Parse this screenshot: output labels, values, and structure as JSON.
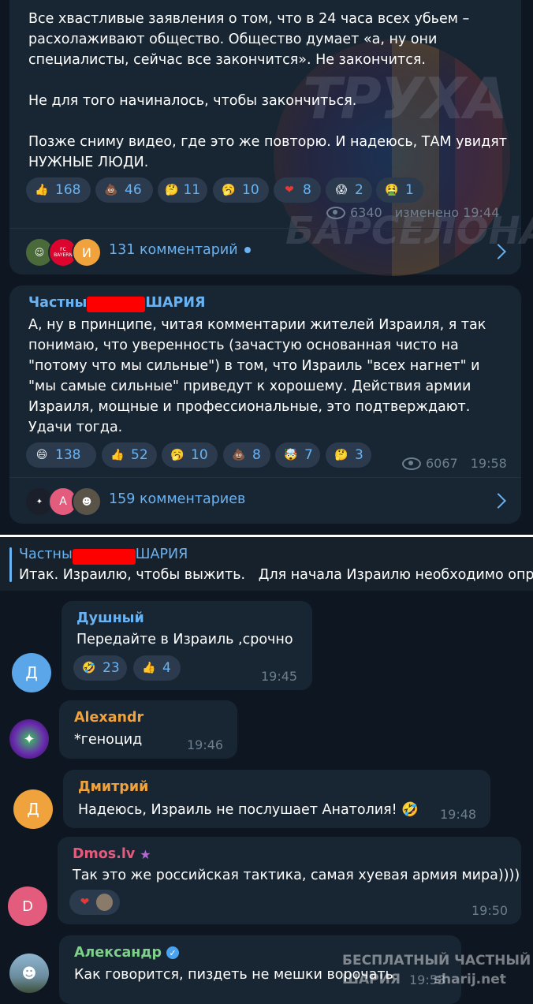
{
  "post1": {
    "text": "Все хвастливые заявления о том, что в 24 часа всех убьем –\nрасхолаживают общество. Общество думает «а, ну они\nспециалисты, сейчас все закончится». Не закончится.\n\nНе для того начиналось, чтобы закончиться.\n\nПозже сниму видео, где это же повторю. И надеюсь, ТАМ увидят\nНУЖНЫЕ ЛЮДИ.",
    "reactions": [
      {
        "emoji": "👍",
        "count": "168"
      },
      {
        "emoji": "💩",
        "count": "46"
      },
      {
        "emoji": "🤔",
        "count": "11"
      },
      {
        "emoji": "🥱",
        "count": "10"
      },
      {
        "emoji": "❤",
        "count": "8"
      },
      {
        "emoji": "😱",
        "count": "2"
      },
      {
        "emoji": "🤮",
        "count": "1"
      }
    ],
    "views": "6340",
    "edited": "изменено 19:44",
    "comments_label": "131 комментарий",
    "watermark_top": "ТРУХА",
    "watermark_bottom": "БАРСЕЛОНА",
    "avatar_badge": "FC BAYERN",
    "avatar_letter": "И"
  },
  "post2": {
    "author_start": "Частны",
    "author_end": "ШАРИЯ",
    "text": "А, ну в принципе, читая комментарии жителей Израиля, я так\nпонимаю, что уверенность (зачастую основанная чисто на\n\"потому что мы сильные\") в том, что Израиль \"всех нагнет\" и\n\"мы самые сильные\" приведут к хорошему. Действия армии\nИзраиля, мощные и профессиональные, это подтверждают.\nУдачи тогда.",
    "reactions": [
      {
        "emoji": "😄",
        "count": "138"
      },
      {
        "emoji": "👍",
        "count": "52"
      },
      {
        "emoji": "🥱",
        "count": "10"
      },
      {
        "emoji": "💩",
        "count": "8"
      },
      {
        "emoji": "🤯",
        "count": "7"
      },
      {
        "emoji": "🤔",
        "count": "3"
      }
    ],
    "views": "6067",
    "time": "19:58",
    "comments_label": "159 комментариев",
    "avatar_letter": "А"
  },
  "pinned": {
    "author_start": "Частны",
    "author_end": "ШАРИЯ",
    "text": "Итак. Израилю, чтобы выжить.   Для начала Израилю необходимо опр"
  },
  "comments": [
    {
      "avatar_letter": "Д",
      "name": "Душный",
      "text": "Передайте в Израиль ,срочно",
      "time": "19:45",
      "reactions": [
        {
          "emoji": "🤣",
          "count": "23"
        },
        {
          "emoji": "👍",
          "count": "4"
        }
      ]
    },
    {
      "name": "Alexandr",
      "text": "*геноцид",
      "time": "19:46"
    },
    {
      "avatar_letter": "Д",
      "name": "Дмитрий",
      "text": "Надеюсь, Израиль не послушает Анатолия! 🤣",
      "time": "19:48"
    },
    {
      "avatar_letter": "D",
      "name": "Dmos.lv",
      "text": "Так это же российская тактика, самая хуевая армия мира))))",
      "time": "19:50",
      "reactions": [
        {
          "emoji": "❤"
        }
      ]
    },
    {
      "name": "Александр",
      "text": "Как говорится, пиздеть не мешки ворочать",
      "time": "19:53"
    }
  ],
  "watermark": {
    "line1": "БЕСПЛАТНЫЙ ЧАСТНЫЙ",
    "line2": "ШАРИЯ",
    "site": "sharij.net"
  },
  "colors": {
    "bg": "#0e1621",
    "bubble": "#182533",
    "accent": "#6ab3f3",
    "reaction": "#2b3b4d"
  }
}
